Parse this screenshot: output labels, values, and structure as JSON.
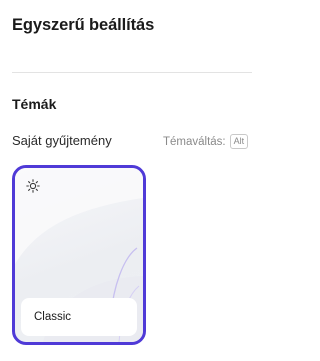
{
  "panel": {
    "title": "Egyszerű beállítás"
  },
  "themes": {
    "heading": "Témák",
    "collection_label": "Saját gyűjtemény",
    "switch_label": "Témaváltás:",
    "switch_value": "Alt",
    "selected": {
      "name": "Classic",
      "icon": "sun-icon",
      "accent_color": "#4f3ad7"
    }
  }
}
